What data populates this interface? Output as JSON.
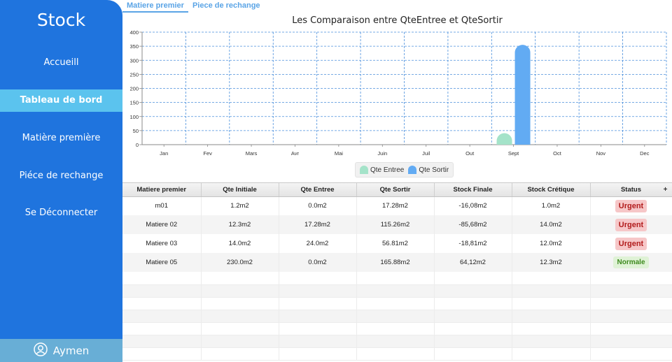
{
  "sidebar": {
    "brand": "Stock",
    "items": [
      {
        "label": "Accueill",
        "active": false
      },
      {
        "label": "Tableau de bord",
        "active": true
      },
      {
        "label": "Matière première",
        "active": false
      },
      {
        "label": "Piéce de rechange",
        "active": false
      },
      {
        "label": "Se Déconnecter",
        "active": false
      }
    ],
    "user": "Aymen"
  },
  "tabs": [
    {
      "label": "Matiere premier",
      "active": true
    },
    {
      "label": "Piece de rechange",
      "active": false
    }
  ],
  "colors": {
    "sidebar": "#1f74de",
    "active_item": "#5bc3ee",
    "entree": "#a4e3c9",
    "sortir": "#62abf3"
  },
  "chart_data": {
    "type": "bar",
    "title": "Les Comparaison entre QteEntree et QteSortir",
    "categories": [
      "Jan",
      "Fev",
      "Mars",
      "Avr",
      "Mai",
      "Juin",
      "Juil",
      "Out",
      "Sept",
      "Oct",
      "Nov",
      "Dec"
    ],
    "series": [
      {
        "name": "Qte Entree",
        "values": [
          0,
          0,
          0,
          0,
          0,
          0,
          0,
          0,
          41,
          0,
          0,
          0
        ]
      },
      {
        "name": "Qte Sortir",
        "values": [
          0,
          0,
          0,
          0,
          0,
          0,
          0,
          0,
          355,
          0,
          0,
          0
        ]
      }
    ],
    "ylim": [
      0,
      400
    ],
    "yticks": [
      0,
      50,
      100,
      150,
      200,
      250,
      300,
      350,
      400
    ],
    "grid": true,
    "legend": "bottom-center"
  },
  "table": {
    "headers": [
      "Matiere premier",
      "Qte Initiale",
      "Qte Entree",
      "Qte Sortir",
      "Stock Finale",
      "Stock Crétique",
      "Status"
    ],
    "rows": [
      [
        "m01",
        "1.2m2",
        "0.0m2",
        "17.28m2",
        "-16,08m2",
        "1.0m2",
        "Urgent"
      ],
      [
        "Matiere 02",
        "12.3m2",
        "17.28m2",
        "115.26m2",
        "-85,68m2",
        "14.0m2",
        "Urgent"
      ],
      [
        "Matiere 03",
        "14.0m2",
        "24.0m2",
        "56.81m2",
        "-18,81m2",
        "12.0m2",
        "Urgent"
      ],
      [
        "Matiere 05",
        "230.0m2",
        "0.0m2",
        "165.88m2",
        "64,12m2",
        "12.3m2",
        "Normale"
      ]
    ],
    "menu_button": "+"
  }
}
